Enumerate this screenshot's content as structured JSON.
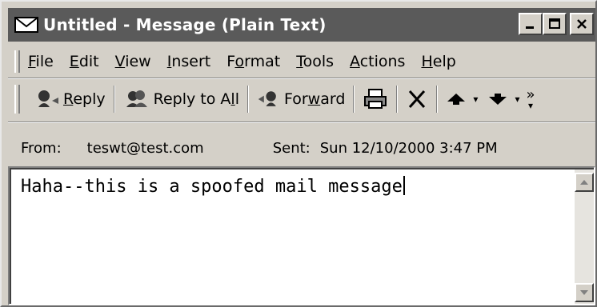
{
  "window": {
    "title": "Untitled - Message (Plain Text)",
    "buttons": [
      "_",
      "□",
      "✕"
    ]
  },
  "menu": [
    {
      "label": "File",
      "ul": "F",
      "rest": "ile"
    },
    {
      "label": "Edit",
      "ul": "E",
      "rest": "dit"
    },
    {
      "label": "View",
      "ul": "V",
      "rest": "iew"
    },
    {
      "label": "Insert",
      "ul": "I",
      "rest": "nsert"
    },
    {
      "label": "Format",
      "pre": "F",
      "ul": "o",
      "rest": "rmat"
    },
    {
      "label": "Tools",
      "ul": "T",
      "rest": "ools"
    },
    {
      "label": "Actions",
      "ul": "A",
      "rest": "ctions"
    },
    {
      "label": "Help",
      "ul": "H",
      "rest": "elp"
    }
  ],
  "toolbar": {
    "reply": {
      "pre": "",
      "ul": "R",
      "rest": "eply",
      "icon": "reply-icon"
    },
    "reply_all": {
      "pre": "Reply to A",
      "ul": "l",
      "rest": "l",
      "icon": "reply-all-icon"
    },
    "forward": {
      "pre": "For",
      "ul": "w",
      "rest": "ard",
      "icon": "forward-icon"
    },
    "print_icon": "print-icon",
    "delete_icon": "delete-icon",
    "prev_icon": "previous-item-icon",
    "next_icon": "next-item-icon",
    "overflow": "»"
  },
  "header": {
    "from_label": "From:",
    "from_value": "teswt@test.com",
    "sent_label": "Sent:",
    "sent_value": "Sun 12/10/2000 3:47 PM"
  },
  "body": {
    "text": "Haha--this is a spoofed mail message"
  },
  "colors": {
    "titlebar": "#5a5a5a",
    "face": "#d4d0c8"
  }
}
